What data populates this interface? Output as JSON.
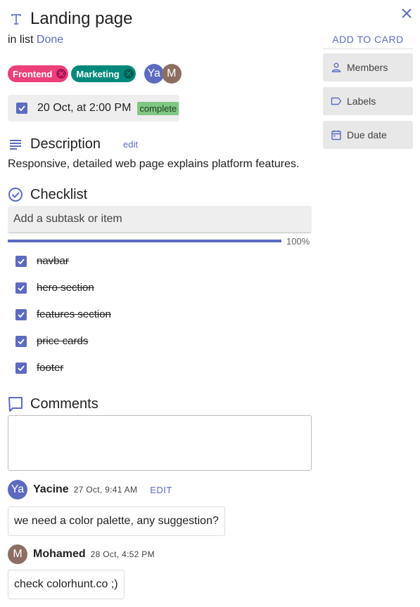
{
  "card": {
    "title": "Landing page",
    "in_list_prefix": "in list",
    "list_name": "Done",
    "labels": [
      {
        "name": "Frontend",
        "color": "#ec407a"
      },
      {
        "name": "Marketing",
        "color": "#00897b"
      }
    ],
    "members": [
      {
        "initials": "Ya",
        "color": "#5c6bc0"
      },
      {
        "initials": "M",
        "color": "#8d6e63"
      }
    ],
    "due": {
      "text": "20 Oct, at 2:00 PM",
      "checked": true,
      "status": "complete"
    }
  },
  "description": {
    "heading": "Description",
    "edit_label": "edit",
    "text": "Responsive, detailed web page explains platform features."
  },
  "checklist": {
    "heading": "Checklist",
    "placeholder": "Add a subtask or item",
    "progress_label": "100%",
    "progress_percent": 100,
    "items": [
      {
        "text": "navbar",
        "done": true
      },
      {
        "text": "hero section",
        "done": true
      },
      {
        "text": "features section",
        "done": true
      },
      {
        "text": "price cards",
        "done": true
      },
      {
        "text": "footer",
        "done": true
      }
    ]
  },
  "comments": {
    "heading": "Comments",
    "input_value": "",
    "items": [
      {
        "author": "Yacine",
        "initials": "Ya",
        "avatar_color": "#5c6bc0",
        "time": "27 Oct, 9:41 AM",
        "edit_label": "EDIT",
        "text": "we need a color palette, any suggestion?"
      },
      {
        "author": "Mohamed",
        "initials": "M",
        "avatar_color": "#8d6e63",
        "time": "28 Oct, 4:52 PM",
        "text": "check colorhunt.co ;)"
      }
    ]
  },
  "sidebar": {
    "title": "ADD TO CARD",
    "buttons": [
      {
        "label": "Members",
        "icon": "person-icon"
      },
      {
        "label": "Labels",
        "icon": "label-icon"
      },
      {
        "label": "Due date",
        "icon": "calendar-icon"
      }
    ]
  },
  "colors": {
    "accent": "#5c6bc0",
    "complete_badge": "#81c784"
  }
}
